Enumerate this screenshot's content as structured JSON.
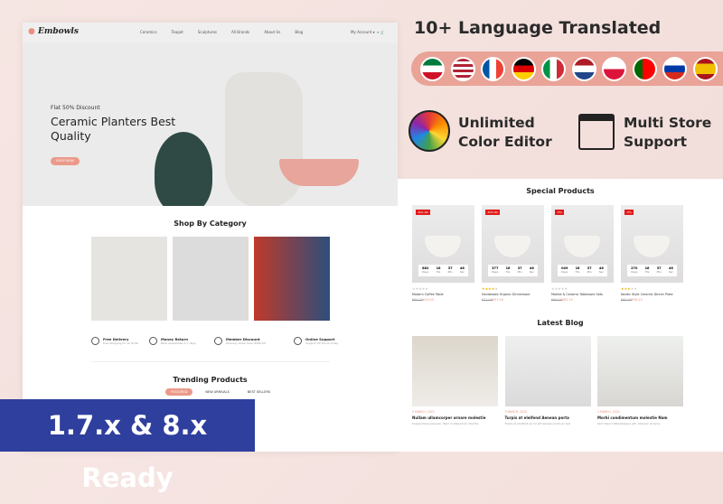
{
  "site": {
    "logo": "Embowls",
    "nav": [
      "Ceramics",
      "Teapot",
      "Sculptures",
      "All Brands",
      "About Us",
      "Blog"
    ],
    "account": "My Account",
    "cart_count": "0"
  },
  "hero": {
    "discount": "Flat 50% Discount",
    "title": "Ceramic Planters Best Quality",
    "button": "SHOP NOW"
  },
  "category": {
    "title": "Shop By Category"
  },
  "features": [
    {
      "title": "Free Delivery",
      "text": "Free Shipping for all Order",
      "icon": "truck-icon"
    },
    {
      "title": "Money Return",
      "text": "Back Guarantee in 7 days",
      "icon": "money-return-icon"
    },
    {
      "title": "Member Discount",
      "text": "Onevery Order Over €300.00",
      "icon": "discount-icon"
    },
    {
      "title": "Online Support",
      "text": "Support 24 Hours A Day",
      "icon": "support-icon"
    }
  ],
  "trending": {
    "title": "Trending Products",
    "tabs": [
      "FEATURED",
      "NEW ARRIVALS",
      "BEST SELLERS"
    ]
  },
  "promo": {
    "languages_title": "10+ Language Translated",
    "color_editor": "Unlimited Color Editor",
    "multistore": "Multi Store Support",
    "ready": "1.7.x & 8.x Ready",
    "accent": "#e9a397",
    "badge_color": "#2f3f9e"
  },
  "flags": [
    "kuwait",
    "usa",
    "france",
    "germany",
    "italy",
    "netherlands",
    "poland",
    "portugal",
    "russia",
    "spain"
  ],
  "special": {
    "title": "Special Products",
    "units": [
      "Days",
      "Hrs",
      "Min",
      "Sec"
    ],
    "products": [
      {
        "name": "Modern Coffee Table",
        "badge": "-€11.00",
        "old": "€64.00",
        "price": "€53.00",
        "rating": 0,
        "countdown": [
          "882",
          "16",
          "37",
          "46"
        ]
      },
      {
        "name": "Handmade Organic Dinnerware",
        "badge": "-€15.00",
        "old": "€72.00",
        "price": "€57.00",
        "rating": 4,
        "countdown": [
          "377",
          "16",
          "37",
          "46"
        ]
      },
      {
        "name": "Marble & Ceramic Tableware Sets",
        "badge": "-5%",
        "old": "€66.00",
        "price": "€62.20",
        "rating": 0,
        "countdown": [
          "049",
          "16",
          "37",
          "46"
        ]
      },
      {
        "name": "Nordic Style Ceramic Dinner Plate",
        "badge": "-5%",
        "old": "€60.00",
        "price": "€58.20",
        "rating": 3,
        "countdown": [
          "270",
          "16",
          "37",
          "46"
        ]
      }
    ]
  },
  "blog": {
    "title": "Latest Blog",
    "posts": [
      {
        "date": "5 MARCH, 2022",
        "title": "Nullam ullamcorper ornare molestie",
        "text": "Suspendisse posuere, diam in bibendum lobortis,"
      },
      {
        "date": "3 MARCH, 2022",
        "title": "Turpis at eleifend Aenean porta",
        "text": "Turpis at eleifend pa mi elit aenean porta ac sed"
      },
      {
        "date": "1 MARCH, 2022",
        "title": "Morbi condimentum molestie Nam",
        "text": "Sed mauris Pellentesque elit. Aliquam at lacus"
      }
    ]
  }
}
